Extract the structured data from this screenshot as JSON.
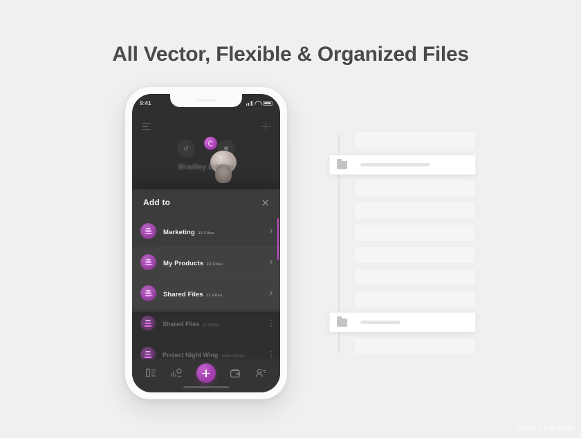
{
  "headline": "All Vector, Flexible & Organized Files",
  "watermark": "www.25xt.com",
  "colors": {
    "background": "#f0f0f0",
    "headline_text": "#4a4a4a",
    "phone_frame": "#fbfbfb",
    "screen_bg": "#2f2f2f",
    "modal_bg": "#3c3c3c",
    "accent_purple": "#a93fb3",
    "accent_magenta": "#dd74e6"
  },
  "phone": {
    "status_bar": {
      "time": "9:41",
      "signal_icon": "cellular-signal-icon",
      "wifi_icon": "wifi-icon",
      "battery_icon": "battery-icon"
    },
    "nav": {
      "menu_icon": "hamburger-menu-icon",
      "add_icon": "plus-icon"
    },
    "profile": {
      "name": "Bradley Edmus",
      "left_action_icon": "history-icon",
      "right_action_icon": "settings-icon",
      "avatar_icon": "user-avatar",
      "badge_icon": "status-badge-icon"
    },
    "background_list": [
      {
        "title": "Shared Files",
        "subtitle": "27 Items",
        "icon": "layers-stack-icon",
        "menu_icon": "more-vertical-icon"
      },
      {
        "title": "Project Night Wing",
        "subtitle": "Allen Durso",
        "icon": "layers-stack-icon",
        "menu_icon": "more-vertical-icon"
      }
    ],
    "modal": {
      "title": "Add to",
      "close_icon": "close-icon",
      "items": [
        {
          "title": "Marketing",
          "subtitle": "30 Files",
          "icon": "layers-stack-icon",
          "chevron_icon": "chevron-right-icon"
        },
        {
          "title": "My Products",
          "subtitle": "23  Files",
          "icon": "layers-stack-icon",
          "chevron_icon": "chevron-right-icon"
        },
        {
          "title": "Shared Files",
          "subtitle": "11 Files",
          "icon": "layers-stack-icon",
          "chevron_icon": "chevron-right-icon"
        }
      ]
    },
    "tabbar": {
      "items": [
        {
          "icon": "list-view-icon"
        },
        {
          "icon": "analytics-chart-icon"
        },
        {
          "icon": "plus-icon"
        },
        {
          "icon": "wallet-icon"
        },
        {
          "icon": "contacts-icon"
        }
      ]
    }
  },
  "layers_panel": {
    "rows": [
      {
        "selected": false
      },
      {
        "selected": true,
        "icon": "folder-icon"
      },
      {
        "selected": false
      },
      {
        "selected": false
      },
      {
        "selected": false
      },
      {
        "selected": false
      },
      {
        "selected": false
      },
      {
        "selected": false
      },
      {
        "selected": true,
        "icon": "folder-icon"
      },
      {
        "selected": false
      }
    ]
  }
}
